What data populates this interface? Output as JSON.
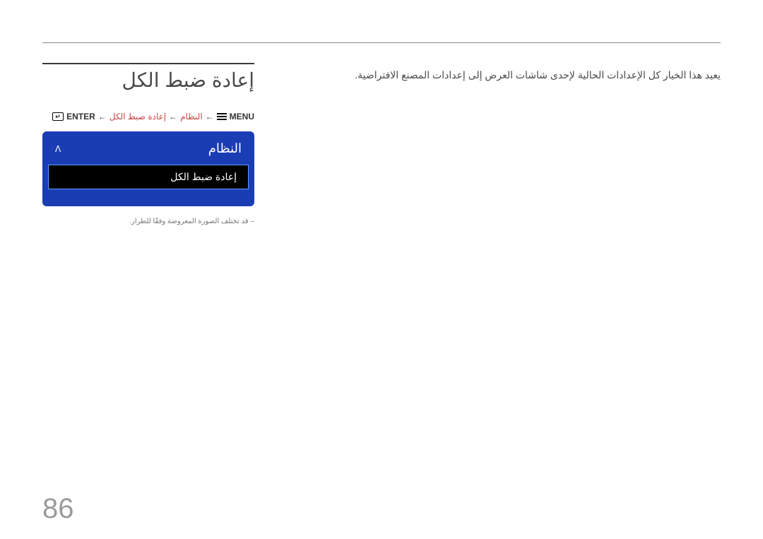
{
  "section": {
    "title": "إعادة ضبط الكل",
    "description": "يعيد هذا الخيار كل الإعدادات الحالية لإحدى شاشات العرض إلى إعدادات المصنع الافتراضية."
  },
  "breadcrumb": {
    "menu_label": "MENU",
    "arrow": "←",
    "system_label": "النظام",
    "reset_label": "إعادة ضبط الكل",
    "enter_label": "ENTER",
    "enter_glyph": "↵"
  },
  "ui_panel": {
    "header": "النظام",
    "up_glyph": "ᐱ",
    "selected_item": "إعادة ضبط الكل"
  },
  "footnote": "– قد تختلف الصورة المعروضة وفقًا للطراز.",
  "page_number": "86"
}
